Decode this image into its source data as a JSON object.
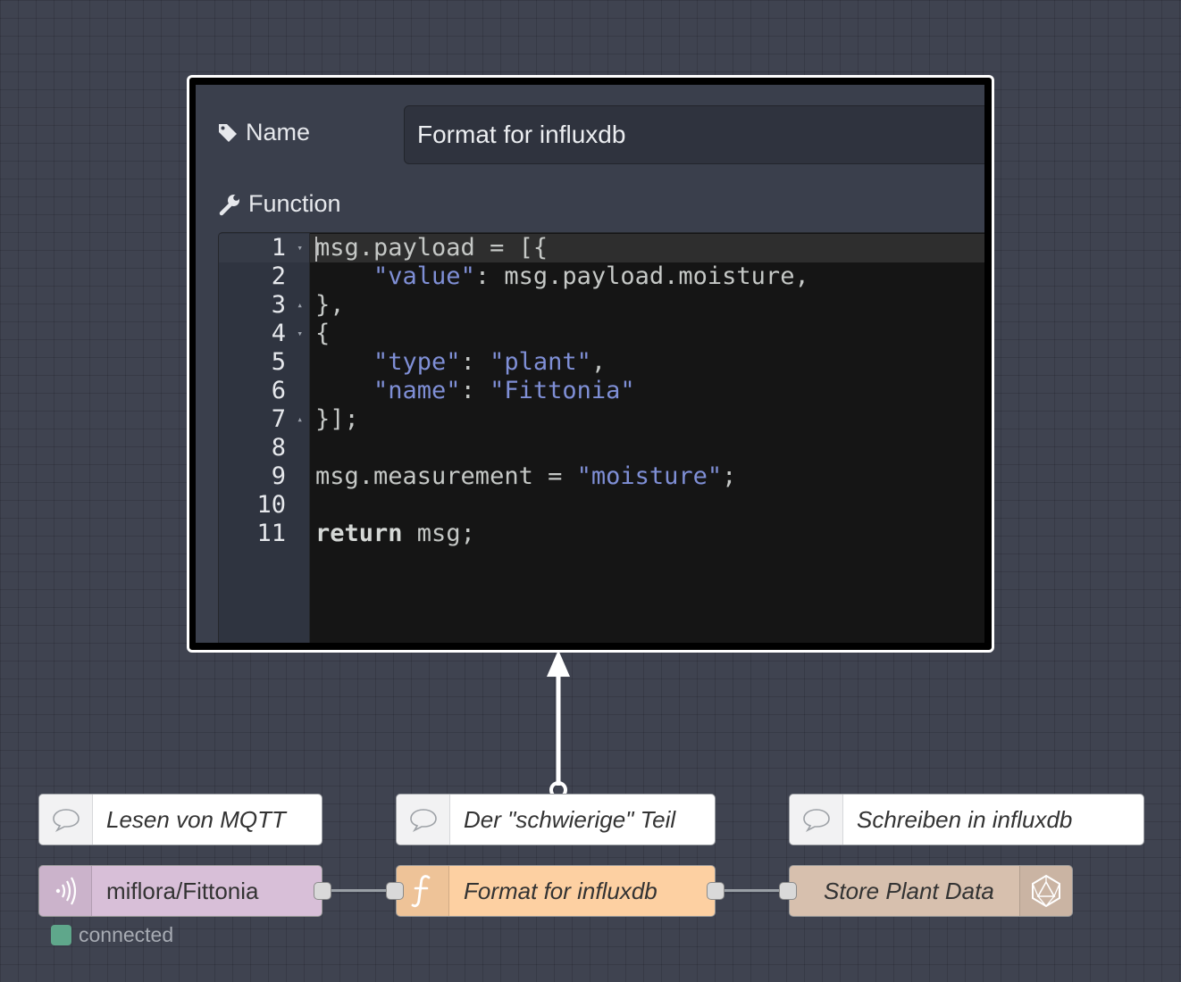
{
  "editor": {
    "name_label": "Name",
    "name_icon": "tag-icon",
    "name_value": "Format for influxdb",
    "function_label": "Function",
    "function_icon": "wrench-icon",
    "code_lines": [
      {
        "num": "1",
        "fold": "▾",
        "text": "msg.payload = [{"
      },
      {
        "num": "2",
        "fold": "",
        "text": "    \"value\": msg.payload.moisture,"
      },
      {
        "num": "3",
        "fold": "▴",
        "text": "},"
      },
      {
        "num": "4",
        "fold": "▾",
        "text": "{"
      },
      {
        "num": "5",
        "fold": "",
        "text": "    \"type\": \"plant\","
      },
      {
        "num": "6",
        "fold": "",
        "text": "    \"name\": \"Fittonia\""
      },
      {
        "num": "7",
        "fold": "▴",
        "text": "}];"
      },
      {
        "num": "8",
        "fold": "",
        "text": ""
      },
      {
        "num": "9",
        "fold": "",
        "text": "msg.measurement = \"moisture\";"
      },
      {
        "num": "10",
        "fold": "",
        "text": ""
      },
      {
        "num": "11",
        "fold": "",
        "text": "return msg;"
      }
    ],
    "colors": {
      "string": "#7f8fd6",
      "code_bg": "#151515",
      "gutter_bg": "#2f3440",
      "panel_bg": "#3a3f4c"
    }
  },
  "comments": [
    {
      "label": "Lesen von MQTT",
      "icon": "comment-icon"
    },
    {
      "label": "Der \"schwierige\" Teil",
      "icon": "comment-icon"
    },
    {
      "label": "Schreiben in influxdb",
      "icon": "comment-icon"
    }
  ],
  "nodes": {
    "mqtt": {
      "label": "miflora/Fittonia",
      "icon": "mqtt-wave-icon",
      "color": "#d8bfd8"
    },
    "function": {
      "label": "Format for influxdb",
      "icon": "function-icon",
      "color": "#fdd0a2"
    },
    "influx": {
      "label": "Store Plant Data",
      "icon": "influxdb-icon",
      "color": "#d7c0ae"
    }
  },
  "status": {
    "text": "connected",
    "color": "#5fa78b"
  }
}
